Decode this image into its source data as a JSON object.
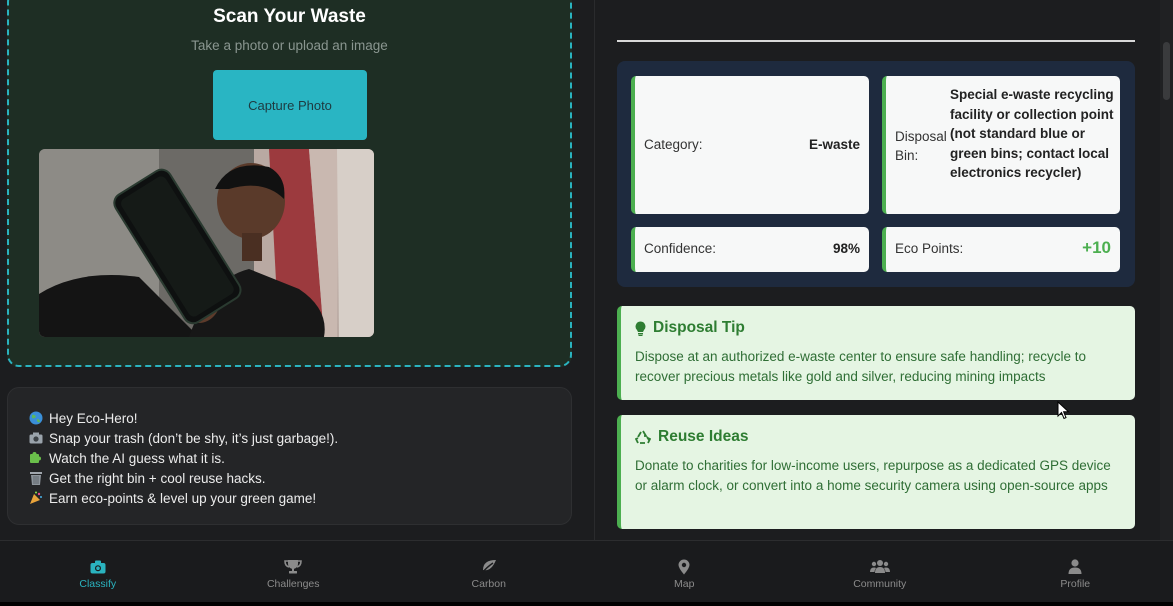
{
  "scan": {
    "title": "Scan Your Waste",
    "subtitle": "Take a photo or upload an image",
    "capture_label": "Capture Photo"
  },
  "intro": {
    "lines": [
      {
        "icon": "globe-icon",
        "text": "Hey Eco-Hero!"
      },
      {
        "icon": "camera-icon",
        "text": "Snap your trash (don’t be shy, it’s just garbage!)."
      },
      {
        "icon": "puzzle-icon",
        "text": "Watch the AI guess what it is."
      },
      {
        "icon": "trash-bin-icon",
        "text": "Get the right bin + cool reuse hacks."
      },
      {
        "icon": "party-icon",
        "text": "Earn eco-points & level up your green game!"
      }
    ]
  },
  "result": {
    "category_label": "Category:",
    "category_value": "E-waste",
    "bin_label_1": "Disposal",
    "bin_label_2": "Bin:",
    "bin_value": "Special e-waste recycling facility or collection point (not standard blue or green bins; contact local electronics recycler)",
    "confidence_label": "Confidence:",
    "confidence_value": "98%",
    "points_label": "Eco Points:",
    "points_value": "+10"
  },
  "tip": {
    "title": "Disposal Tip",
    "body": "Dispose at an authorized e-waste center to ensure safe handling; recycle to recover precious metals like gold and silver, reducing mining impacts"
  },
  "reuse": {
    "title": "Reuse Ideas",
    "body": "Donate to charities for low-income users, repurpose as a dedicated GPS device or alarm clock, or convert into a home security camera using open-source apps"
  },
  "nav": {
    "items": [
      {
        "label": "Classify",
        "icon": "camera-icon",
        "active": true
      },
      {
        "label": "Challenges",
        "icon": "trophy-icon",
        "active": false
      },
      {
        "label": "Carbon",
        "icon": "leaf-icon",
        "active": false
      },
      {
        "label": "Map",
        "icon": "map-pin-icon",
        "active": false
      },
      {
        "label": "Community",
        "icon": "users-icon",
        "active": false
      },
      {
        "label": "Profile",
        "icon": "user-icon",
        "active": false
      }
    ]
  },
  "colors": {
    "accent": "#2ab3bf",
    "green": "#4caf50",
    "points": "#4caf50",
    "tip_bg": "#e5f5e3"
  }
}
